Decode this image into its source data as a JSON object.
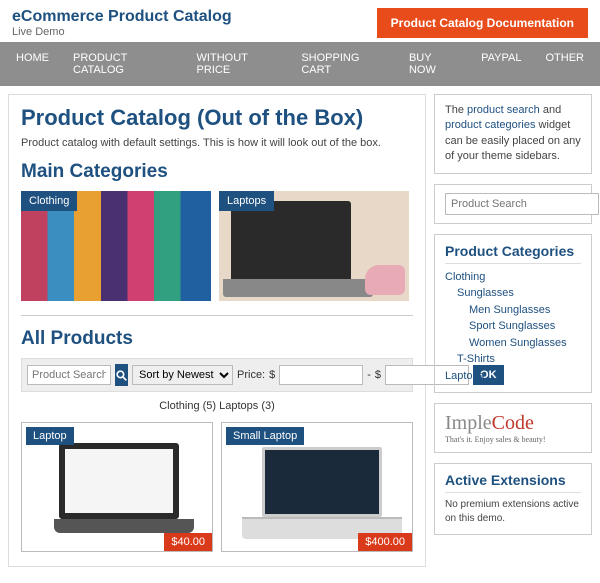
{
  "header": {
    "title": "eCommerce Product Catalog",
    "subtitle": "Live Demo",
    "doc_button": "Product Catalog Documentation"
  },
  "nav": [
    "HOME",
    "PRODUCT CATALOG",
    "WITHOUT PRICE",
    "SHOPPING CART",
    "BUY NOW",
    "PAYPAL",
    "OTHER"
  ],
  "page": {
    "title": "Product Catalog (Out of the Box)",
    "desc": "Product catalog with default settings. This is how it will look out of the box."
  },
  "main_categories": {
    "heading": "Main Categories",
    "items": [
      {
        "label": "Clothing"
      },
      {
        "label": "Laptops"
      }
    ]
  },
  "all_products": {
    "heading": "All Products",
    "search_placeholder": "Product Search",
    "sort_selected": "Sort by Newest",
    "price_label": "Price:",
    "currency": "$",
    "dash": "-",
    "ok": "OK",
    "counts": "Clothing (5)  Laptops (3)",
    "products": [
      {
        "name": "Laptop",
        "price": "$40.00"
      },
      {
        "name": "Small Laptop",
        "price": "$400.00"
      }
    ]
  },
  "sidebar": {
    "intro": {
      "link1": "product search",
      "mid": " and ",
      "link2": "product categories",
      "rest": " widget can be easily placed on any of your theme sidebars."
    },
    "search_placeholder": "Product Search",
    "categories": {
      "title": "Product Categories",
      "tree": [
        "Clothing",
        "Sunglasses",
        "Men Sunglasses",
        "Sport Sunglasses",
        "Women Sunglasses",
        "T-Shirts",
        "Laptops"
      ]
    },
    "logo": {
      "part1": "Imple",
      "part2": "Code",
      "tagline": "That's it. Enjoy sales & beauty!"
    },
    "extensions": {
      "title": "Active Extensions",
      "text": "No premium extensions active on this demo."
    }
  }
}
